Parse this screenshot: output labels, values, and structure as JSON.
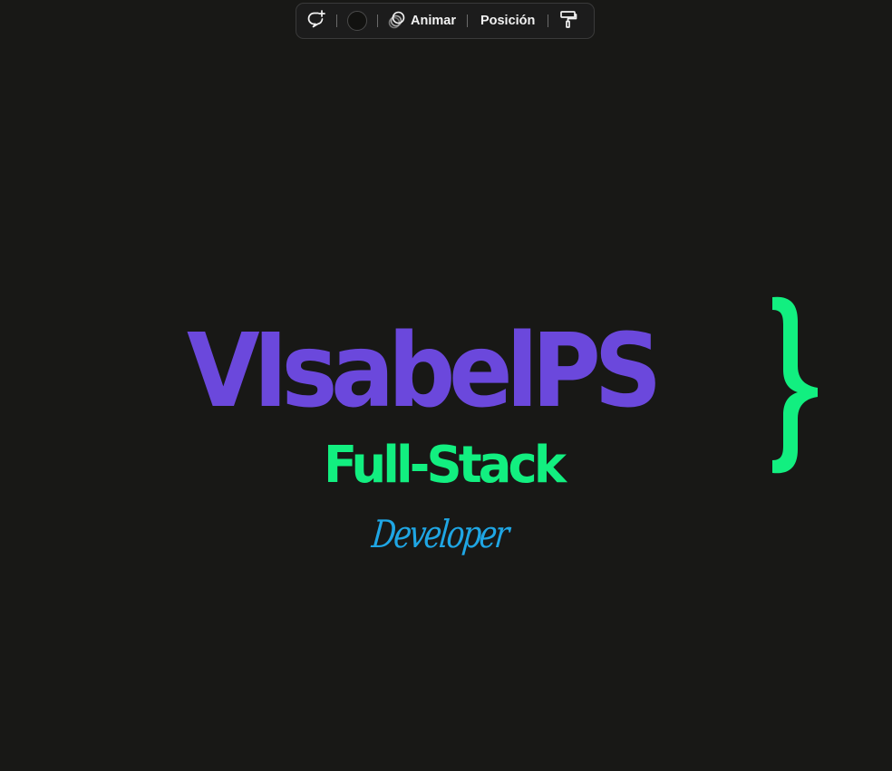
{
  "toolbar": {
    "comment_icon": "comment-plus-icon",
    "color_value": "#121210",
    "animate_icon": "animate-circles-icon",
    "animate_label": "Animar",
    "position_label": "Posición",
    "paint_icon": "paint-roller-icon"
  },
  "design": {
    "title": "VIsabelPS",
    "subtitle": "Full-Stack",
    "role": "Developer",
    "brace_icon": "curly-brace-icon"
  },
  "colors": {
    "background": "#181816",
    "title": "#6b48dc",
    "subtitle": "#12ef80",
    "role": "#1fa6e4",
    "brace": "#12ef80"
  }
}
